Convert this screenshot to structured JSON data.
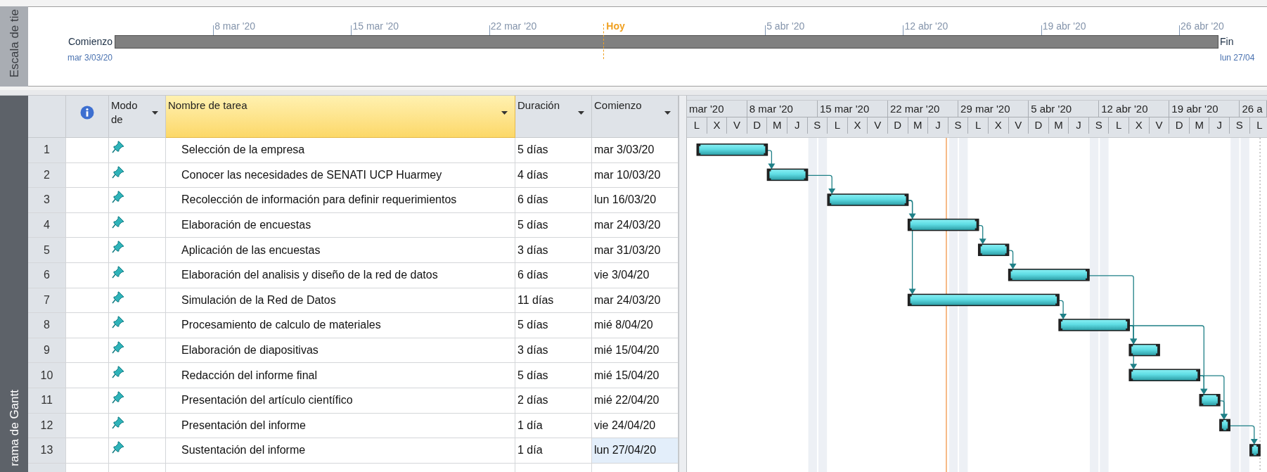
{
  "timeline": {
    "side_label": "Escala de tie",
    "start_label": "Comienzo",
    "start_date": "mar 3/03/20",
    "end_label": "Fin",
    "end_date": "lun 27/04",
    "ticks": [
      {
        "kind": "date",
        "label": "8 mar '20"
      },
      {
        "kind": "date",
        "label": "15 mar '20"
      },
      {
        "kind": "date",
        "label": "22 mar '20"
      },
      {
        "kind": "today",
        "label": "Hoy"
      },
      {
        "kind": "date",
        "label": "5 abr '20"
      },
      {
        "kind": "date",
        "label": "12 abr '20"
      },
      {
        "kind": "date",
        "label": "19 abr '20"
      },
      {
        "kind": "date",
        "label": "26 abr '20"
      }
    ]
  },
  "view_label": "rama de Gantt",
  "table": {
    "columns": [
      {
        "kind": "number",
        "selected": false
      },
      {
        "kind": "info",
        "selected": false
      },
      {
        "kind": "mode",
        "label": "Modo de",
        "selected": false
      },
      {
        "kind": "name",
        "label": "Nombre de tarea",
        "selected": true
      },
      {
        "kind": "duration",
        "label": "Duración",
        "selected": false
      },
      {
        "kind": "start",
        "label": "Comienzo",
        "selected": false
      }
    ],
    "rows": [
      {
        "id": "1",
        "name": "Selección de la empresa",
        "duration": "5 días",
        "start": "mar 3/03/20",
        "selected": false
      },
      {
        "id": "2",
        "name": "Conocer las necesidades de SENATI UCP Huarmey",
        "duration": "4 días",
        "start": "mar 10/03/20",
        "selected": false
      },
      {
        "id": "3",
        "name": "Recolección de información para definir requerimientos",
        "duration": "6 días",
        "start": "lun 16/03/20",
        "selected": false
      },
      {
        "id": "4",
        "name": "Elaboración de encuestas",
        "duration": "5 días",
        "start": "mar 24/03/20",
        "selected": false
      },
      {
        "id": "5",
        "name": "Aplicación de las encuestas",
        "duration": "3 días",
        "start": "mar 31/03/20",
        "selected": false
      },
      {
        "id": "6",
        "name": "Elaboración del analisis y diseño de la red de datos",
        "duration": "6 días",
        "start": "vie 3/04/20",
        "selected": false
      },
      {
        "id": "7",
        "name": "Simulación de la Red de Datos",
        "duration": "11 días",
        "start": "mar 24/03/20",
        "selected": false
      },
      {
        "id": "8",
        "name": "Procesamiento de calculo de materiales",
        "duration": "5 días",
        "start": "mié 8/04/20",
        "selected": false
      },
      {
        "id": "9",
        "name": "Elaboración de diapositivas",
        "duration": "3 días",
        "start": "mié 15/04/20",
        "selected": false
      },
      {
        "id": "10",
        "name": "Redacción del informe final",
        "duration": "5 días",
        "start": "mié 15/04/20",
        "selected": false
      },
      {
        "id": "11",
        "name": "Presentación del artículo científico",
        "duration": "2 días",
        "start": "mié 22/04/20",
        "selected": false
      },
      {
        "id": "12",
        "name": "Presentación del informe",
        "duration": "1 día",
        "start": "vie 24/04/20",
        "selected": false
      },
      {
        "id": "13",
        "name": "Sustentación del informe",
        "duration": "1 día",
        "start": "lun 27/04/20",
        "selected": true
      }
    ]
  },
  "gantt": {
    "weeks": [
      "mar '20",
      "8 mar '20",
      "15 mar '20",
      "22 mar '20",
      "29 mar '20",
      "5 abr '20",
      "12 abr '20",
      "19 abr '20",
      "26 a"
    ],
    "days": [
      "L",
      "X",
      "V",
      "D",
      "M",
      "J",
      "S",
      "L",
      "X",
      "V",
      "D",
      "M",
      "J",
      "S",
      "L",
      "X",
      "V",
      "D",
      "M",
      "J",
      "S",
      "L",
      "X",
      "V",
      "D",
      "M",
      "J",
      "S",
      "L"
    ]
  }
}
